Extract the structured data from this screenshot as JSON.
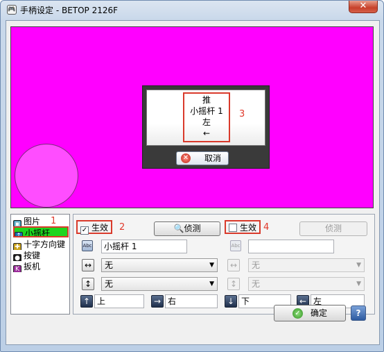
{
  "window": {
    "title": "手柄设定 - BETOP 2126F",
    "app_icon_glyph": "🎮",
    "close_glyph": "✕"
  },
  "preview": {
    "background_color": "#ff00ff",
    "popup": {
      "line1": "推",
      "line2": "小摇杆 1",
      "line3": "左",
      "arrow": "←",
      "cancel_label": "取消"
    },
    "annotation": "3"
  },
  "list": {
    "items": [
      {
        "label": "图片",
        "icon": "picture-icon",
        "color": "#2a8fb0",
        "glyph": "▣"
      },
      {
        "label": "小摇杆",
        "icon": "joystick-icon",
        "color": "#1c6fb0",
        "glyph": "↑"
      },
      {
        "label": "十字方向键",
        "icon": "dpad-icon",
        "color": "#c9a11a",
        "glyph": "✚"
      },
      {
        "label": "按键",
        "icon": "button-icon",
        "color": "#1a1a1a",
        "glyph": "●"
      },
      {
        "label": "扳机",
        "icon": "trigger-icon",
        "color": "#9b2c9b",
        "glyph": "K"
      }
    ],
    "selected_index": 1,
    "annotation": "1"
  },
  "panel": {
    "left": {
      "enable_label": "生效",
      "enable_checked": true,
      "enable_annotation": "2",
      "detect_label": "侦测",
      "name_value": "小摇杆 1",
      "select_horizontal": "无",
      "select_vertical": "无",
      "dir_up": "上",
      "dir_right": "右"
    },
    "right": {
      "enable_label": "生效",
      "enable_checked": false,
      "enable_annotation": "4",
      "detect_label": "侦测",
      "name_value": "",
      "select_horizontal": "无",
      "select_vertical": "无",
      "dir_down": "下",
      "dir_left": "左"
    },
    "abc_glyph": "Abc"
  },
  "footer": {
    "ok_label": "确定",
    "help_glyph": "?"
  }
}
